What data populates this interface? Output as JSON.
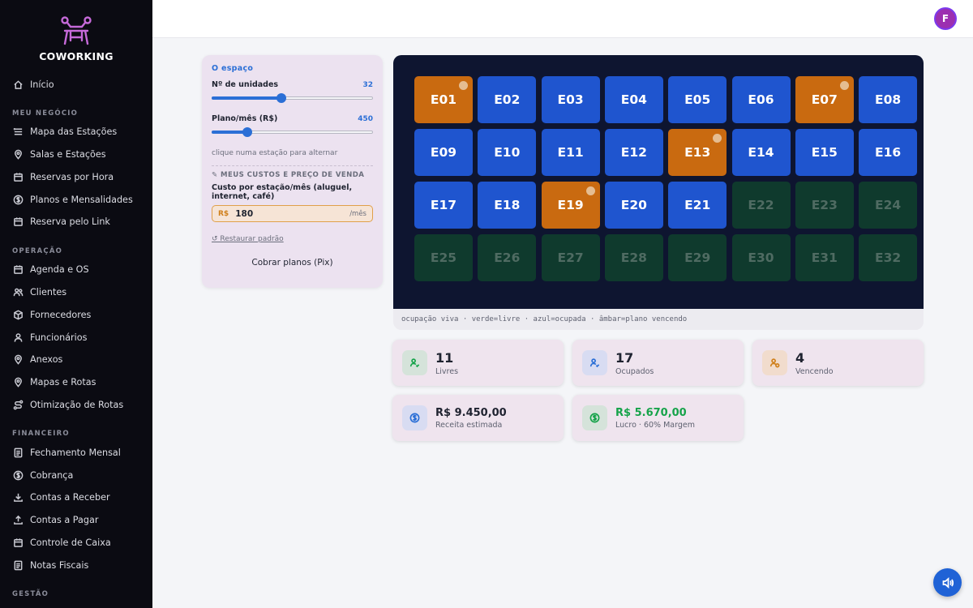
{
  "brand": {
    "name": "COWORKING"
  },
  "sidebar": {
    "home": "Início",
    "sections": [
      {
        "title": "MEU NEGÓCIO",
        "items": [
          "Mapa das Estações",
          "Salas e Estações",
          "Reservas por Hora",
          "Planos e Mensalidades",
          "Reserva pelo Link"
        ]
      },
      {
        "title": "OPERAÇÃO",
        "items": [
          "Agenda e OS",
          "Clientes",
          "Fornecedores",
          "Funcionários",
          "Anexos",
          "Mapas e Rotas",
          "Otimização de Rotas"
        ]
      },
      {
        "title": "FINANCEIRO",
        "items": [
          "Fechamento Mensal",
          "Cobrança",
          "Contas a Receber",
          "Contas a Pagar",
          "Controle de Caixa",
          "Notas Fiscais"
        ]
      },
      {
        "title": "GESTÃO",
        "items": []
      }
    ]
  },
  "user": {
    "initial": "F"
  },
  "space_panel": {
    "title": "O espaço",
    "units_label": "Nº de unidades",
    "units_value": "32",
    "units_fraction": 0.43,
    "plan_label": "Plano/mês (R$)",
    "plan_value": "450",
    "plan_fraction": 0.22,
    "hint": "clique numa estação para alternar",
    "costs_title": "✎ MEUS CUSTOS E PREÇO DE VENDA",
    "cost_label": "Custo por estação/mês (aluguel, internet, café)",
    "cost_currency": "R$",
    "cost_value": "180",
    "cost_suffix": "/mês",
    "restore": "↺ Restaurar padrão",
    "charge_button": "Cobrar planos (Pix)"
  },
  "stations": [
    {
      "id": "E01",
      "status": "amber"
    },
    {
      "id": "E02",
      "status": "blue"
    },
    {
      "id": "E03",
      "status": "blue"
    },
    {
      "id": "E04",
      "status": "blue"
    },
    {
      "id": "E05",
      "status": "blue"
    },
    {
      "id": "E06",
      "status": "blue"
    },
    {
      "id": "E07",
      "status": "amber"
    },
    {
      "id": "E08",
      "status": "blue"
    },
    {
      "id": "E09",
      "status": "blue"
    },
    {
      "id": "E10",
      "status": "blue"
    },
    {
      "id": "E11",
      "status": "blue"
    },
    {
      "id": "E12",
      "status": "blue"
    },
    {
      "id": "E13",
      "status": "amber"
    },
    {
      "id": "E14",
      "status": "blue"
    },
    {
      "id": "E15",
      "status": "blue"
    },
    {
      "id": "E16",
      "status": "blue"
    },
    {
      "id": "E17",
      "status": "blue"
    },
    {
      "id": "E18",
      "status": "blue"
    },
    {
      "id": "E19",
      "status": "amber"
    },
    {
      "id": "E20",
      "status": "blue"
    },
    {
      "id": "E21",
      "status": "blue"
    },
    {
      "id": "E22",
      "status": "green"
    },
    {
      "id": "E23",
      "status": "green"
    },
    {
      "id": "E24",
      "status": "green"
    },
    {
      "id": "E25",
      "status": "green"
    },
    {
      "id": "E26",
      "status": "green"
    },
    {
      "id": "E27",
      "status": "green"
    },
    {
      "id": "E28",
      "status": "green"
    },
    {
      "id": "E29",
      "status": "green"
    },
    {
      "id": "E30",
      "status": "green"
    },
    {
      "id": "E31",
      "status": "green"
    },
    {
      "id": "E32",
      "status": "green"
    }
  ],
  "legend": "ocupação viva · verde=livre · azul=ocupada · âmbar=plano vencendo",
  "stats": {
    "free": {
      "value": "11",
      "label": "Livres"
    },
    "occupied": {
      "value": "17",
      "label": "Ocupados"
    },
    "expiring": {
      "value": "4",
      "label": "Vencendo"
    },
    "revenue": {
      "value": "R$ 9.450,00",
      "label": "Receita estimada"
    },
    "profit": {
      "value": "R$ 5.670,00",
      "label": "Lucro · 60% Margem"
    }
  },
  "colors": {
    "occupied": "#1f55cf",
    "expiring": "#c96a10",
    "free": "#0f3a2d",
    "accent": "#2b6fd6",
    "profit": "#16a34a"
  }
}
